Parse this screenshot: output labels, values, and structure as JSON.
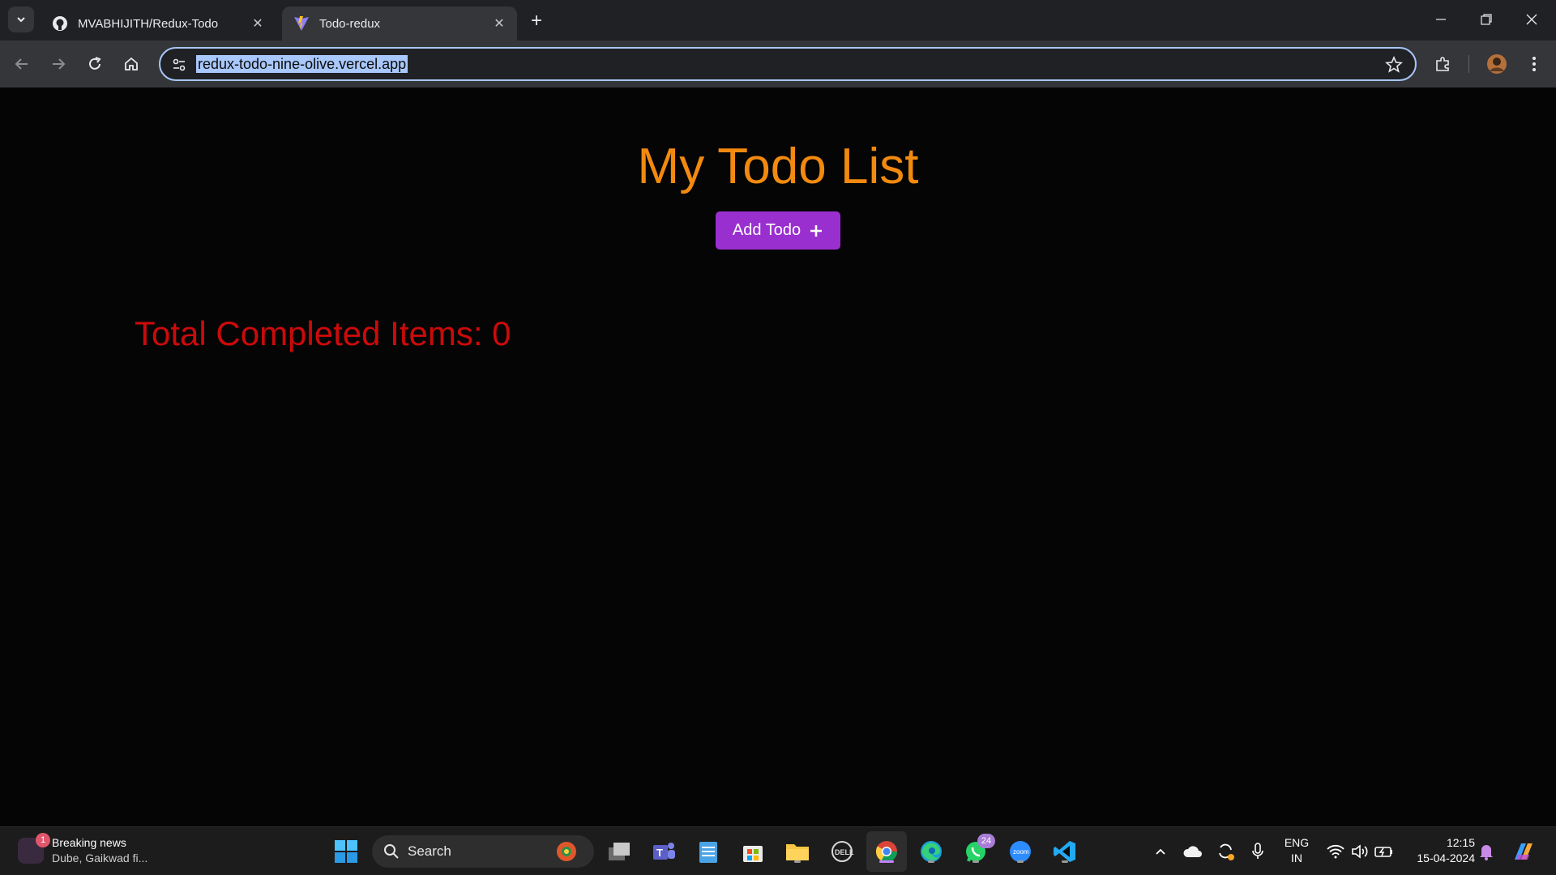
{
  "browser": {
    "tabs": [
      {
        "title": "MVABHIJITH/Redux-Todo",
        "icon": "github-icon",
        "active": false
      },
      {
        "title": "Todo-redux",
        "icon": "vite-icon",
        "active": true
      }
    ],
    "url": "redux-todo-nine-olive.vercel.app"
  },
  "page": {
    "title": "My Todo List",
    "add_button_label": "Add Todo",
    "add_button_icon": "plus-icon",
    "completed_text": "Total Completed Items: 0",
    "colors": {
      "title": "#f28a0f",
      "button": "#9a2fcf",
      "completed": "#cc0a0a",
      "background": "#050505"
    }
  },
  "taskbar": {
    "news_title": "Breaking news",
    "news_subtitle": "Dube, Gaikwad fi...",
    "news_badge": "1",
    "search_placeholder": "Search",
    "whatsapp_badge": "24",
    "lang_primary": "ENG",
    "lang_secondary": "IN",
    "time": "12:15",
    "date": "15-04-2024"
  }
}
